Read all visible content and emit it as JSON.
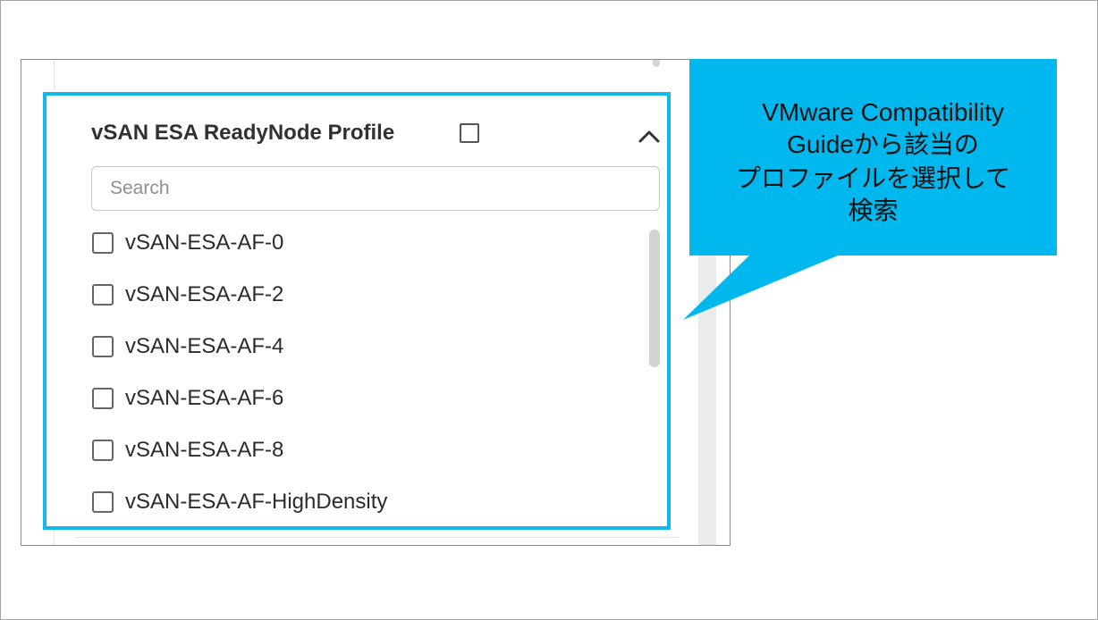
{
  "panel": {
    "title": "vSAN ESA ReadyNode Profile",
    "search_placeholder": "Search",
    "options": [
      {
        "label": "vSAN-ESA-AF-0",
        "checked": false
      },
      {
        "label": "vSAN-ESA-AF-2",
        "checked": false
      },
      {
        "label": "vSAN-ESA-AF-4",
        "checked": false
      },
      {
        "label": "vSAN-ESA-AF-6",
        "checked": false
      },
      {
        "label": "vSAN-ESA-AF-8",
        "checked": false
      },
      {
        "label": "vSAN-ESA-AF-HighDensity",
        "checked": false
      }
    ],
    "icons": {
      "collapse": "chevron-up-icon"
    }
  },
  "callout": {
    "lines": [
      "VMware Compatibility",
      "Guideから該当の",
      "プロファイルを選択して",
      "検索"
    ]
  },
  "colors": {
    "highlight": "#12b8ea",
    "callout_background": "#00b8ed"
  }
}
